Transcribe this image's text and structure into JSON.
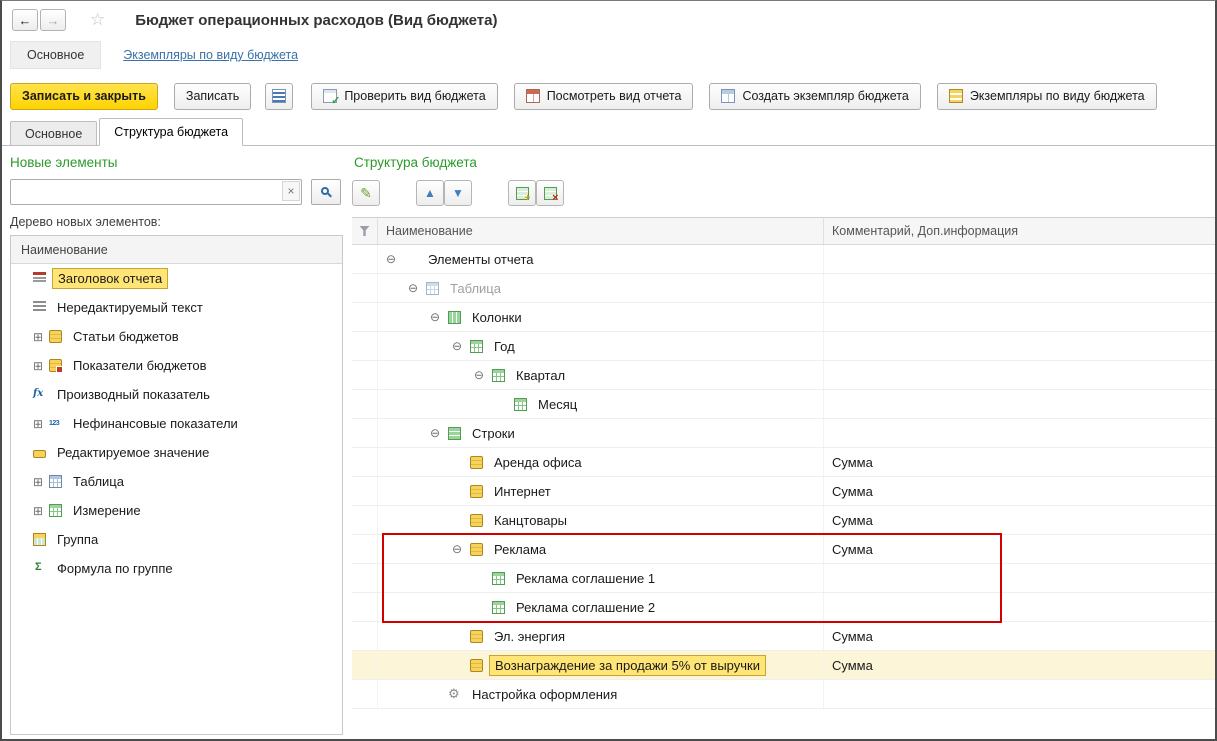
{
  "window": {
    "title": "Бюджет операционных расходов  (Вид бюджета)"
  },
  "header_nav": {
    "main": "Основное",
    "instances_link": "Экземпляры по виду бюджета"
  },
  "command_bar": {
    "save_and_close": "Записать и закрыть",
    "save": "Записать",
    "check_budget_view": "Проверить вид бюджета",
    "view_report": "Посмотреть вид отчета",
    "create_budget_instance": "Создать экземпляр бюджета",
    "instances_by_budget_view": "Экземпляры по виду бюджета"
  },
  "page_tabs": [
    {
      "label": "Основное",
      "active": false
    },
    {
      "label": "Структура бюджета",
      "active": true
    }
  ],
  "left_panel": {
    "title": "Новые элементы",
    "search_value": "",
    "tree_caption": "Дерево новых элементов:",
    "column_header": "Наименование",
    "items": [
      {
        "label": "Заголовок отчета",
        "icon": "report-title",
        "expandable": false,
        "selected": true
      },
      {
        "label": "Нередактируемый текст",
        "icon": "static-text",
        "expandable": false
      },
      {
        "label": "Статьи бюджетов",
        "icon": "budget-items",
        "expandable": true
      },
      {
        "label": "Показатели бюджетов",
        "icon": "budget-indicators",
        "expandable": true
      },
      {
        "label": "Производный показатель",
        "icon": "fx",
        "expandable": false
      },
      {
        "label": "Нефинансовые показатели",
        "icon": "nonfinancial",
        "expandable": true
      },
      {
        "label": "Редактируемое значение",
        "icon": "editable-value",
        "expandable": false
      },
      {
        "label": "Таблица",
        "icon": "table-blue",
        "expandable": true
      },
      {
        "label": "Измерение",
        "icon": "dimension",
        "expandable": true
      },
      {
        "label": "Группа",
        "icon": "group",
        "expandable": false
      },
      {
        "label": "Формула по группе",
        "icon": "group-formula",
        "expandable": false
      }
    ]
  },
  "right_panel": {
    "title": "Структура бюджета",
    "columns": {
      "name": "Наименование",
      "comment": "Комментарий, Доп.информация"
    },
    "rows": [
      {
        "label": "Элементы отчета",
        "level": 0,
        "expander": "minus",
        "icon": null,
        "comment": ""
      },
      {
        "label": "Таблица",
        "level": 1,
        "expander": "minus",
        "icon": "table-blue",
        "comment": "",
        "muted": true
      },
      {
        "label": "Колонки",
        "level": 2,
        "expander": "minus",
        "icon": "columns",
        "comment": ""
      },
      {
        "label": "Год",
        "level": 3,
        "expander": "minus",
        "icon": "dimension",
        "comment": ""
      },
      {
        "label": "Квартал",
        "level": 4,
        "expander": "minus",
        "icon": "dimension",
        "comment": ""
      },
      {
        "label": "Месяц",
        "level": 5,
        "expander": null,
        "icon": "dimension",
        "comment": ""
      },
      {
        "label": "Строки",
        "level": 2,
        "expander": "minus",
        "icon": "rows",
        "comment": ""
      },
      {
        "label": "Аренда офиса",
        "level": 3,
        "expander": null,
        "icon": "budget-items",
        "comment": "Сумма"
      },
      {
        "label": "Интернет",
        "level": 3,
        "expander": null,
        "icon": "budget-items",
        "comment": "Сумма"
      },
      {
        "label": "Канцтовары",
        "level": 3,
        "expander": null,
        "icon": "budget-items",
        "comment": "Сумма"
      },
      {
        "label": "Реклама",
        "level": 3,
        "expander": "minus",
        "icon": "budget-items",
        "comment": "Сумма"
      },
      {
        "label": "Реклама соглашение 1",
        "level": 4,
        "expander": null,
        "icon": "dimension",
        "comment": ""
      },
      {
        "label": "Реклама соглашение 2",
        "level": 4,
        "expander": null,
        "icon": "dimension",
        "comment": ""
      },
      {
        "label": "Эл. энергия",
        "level": 3,
        "expander": null,
        "icon": "budget-items",
        "comment": "Сумма"
      },
      {
        "label": "Вознаграждение  за продажи 5% от выручки",
        "level": 3,
        "expander": null,
        "icon": "budget-items",
        "comment": "Сумма",
        "selected": true
      },
      {
        "label": "Настройка оформления",
        "level": 2,
        "expander": null,
        "icon": "gear",
        "comment": ""
      }
    ]
  },
  "colors": {
    "primary_button": "#ffd400",
    "section_title": "#2b9a2b",
    "link": "#3a71a8",
    "selection": "#ffe476",
    "annotation_box": "#d40000"
  }
}
